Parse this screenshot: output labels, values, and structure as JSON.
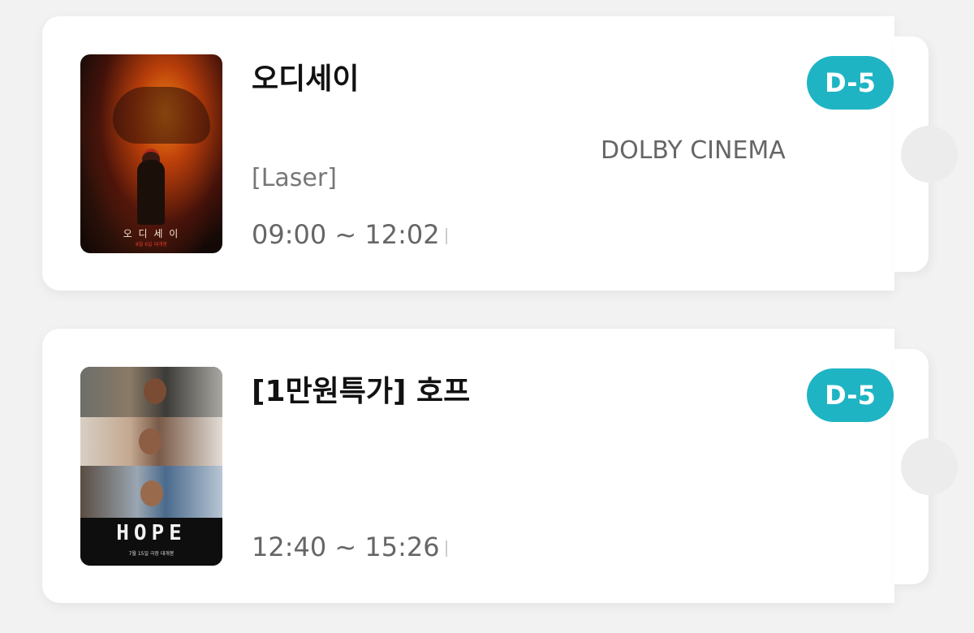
{
  "tickets": [
    {
      "title": "오디세이",
      "screen": "DOLBY CINEMA",
      "format": "[Laser]",
      "showtime": "09:00 ~ 12:02",
      "badge": "D-5",
      "badge_color": "#1fb4c4",
      "poster": {
        "title": "오 디 세 이",
        "subtitle": "8월 6일 대개봉"
      }
    },
    {
      "title": "[1만원특가] 호프",
      "showtime": "12:40 ~ 15:26",
      "badge": "D-5",
      "badge_color": "#1fb4c4",
      "poster": {
        "title": "HOPE",
        "subtitle": "7월 15일 극장 대개봉"
      }
    }
  ]
}
